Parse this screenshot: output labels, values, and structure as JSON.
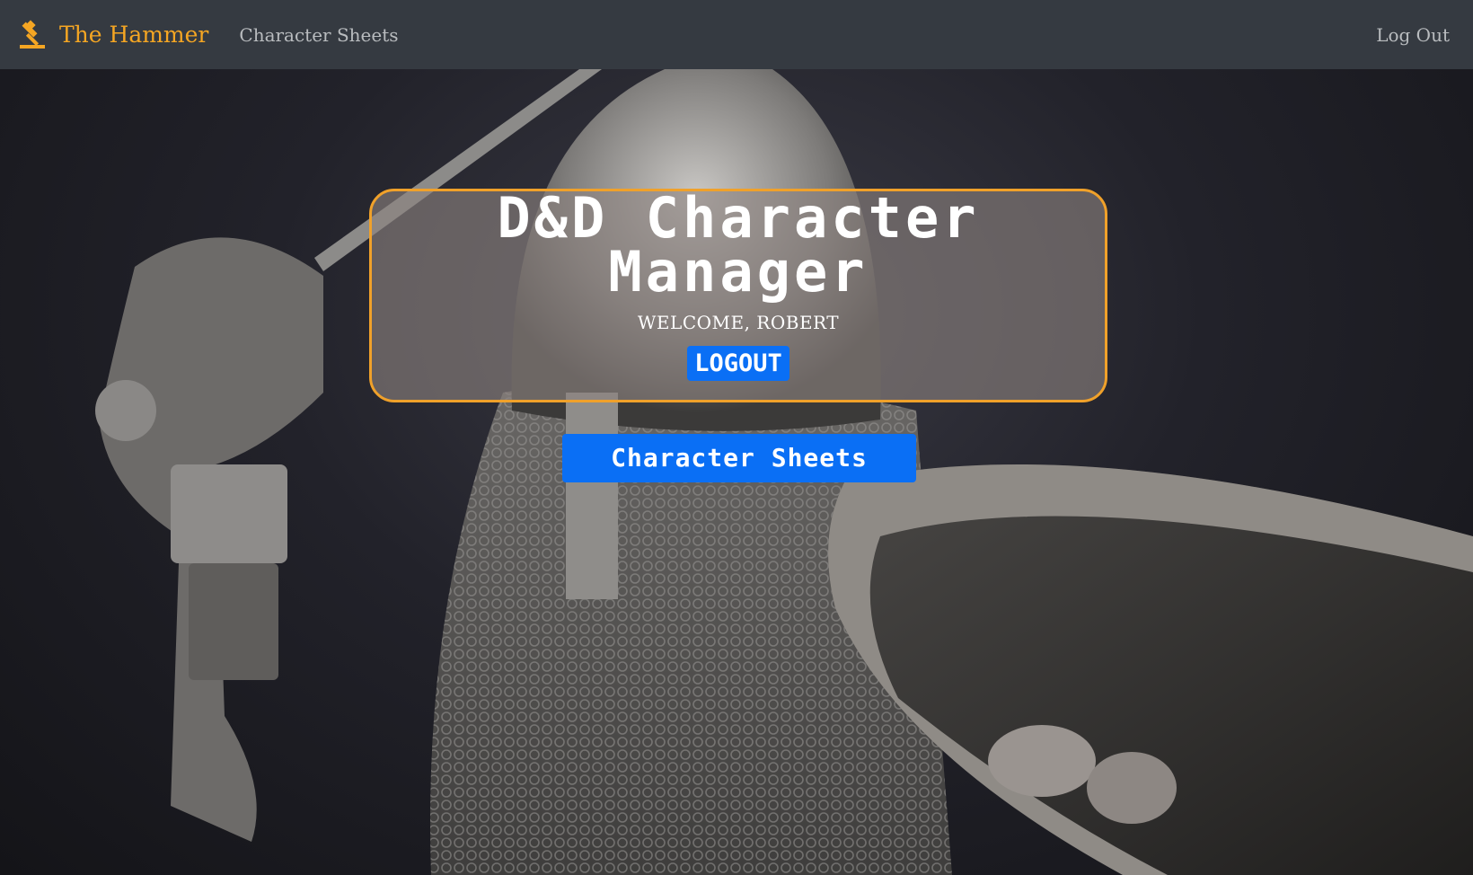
{
  "navbar": {
    "brand_icon": "gavel-icon",
    "brand_label": "The Hammer",
    "link_character_sheets": "Character Sheets",
    "logout_link": "Log Out",
    "brand_color": "#f5a623",
    "background_color": "#353a41"
  },
  "hero": {
    "background_image": "knight-with-sword-and-shield-photo",
    "title": "D&D Character Manager",
    "welcome": "WELCOME, ROBERT",
    "logout_button": "LOGOUT",
    "character_sheets_button": "Character Sheets",
    "accent_border_color": "#f0a12a",
    "button_color": "#0a6ff5"
  }
}
